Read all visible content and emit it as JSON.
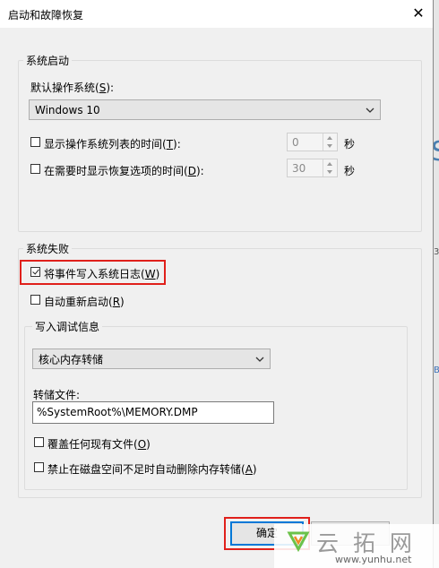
{
  "window": {
    "title": "启动和故障恢复",
    "close_glyph": "✕"
  },
  "background": {
    "letter_s": "S",
    "digit": "3",
    "letter_b": "B"
  },
  "system_startup": {
    "legend": "系统启动",
    "default_os_label_text": "默认操作系统(",
    "default_os_label_key": "S",
    "default_os_label_end": "):",
    "default_os_value": "Windows 10",
    "show_list": {
      "label_text": "显示操作系统列表的时间(",
      "key": "T",
      "label_end": "):",
      "checked": false,
      "value": "0",
      "unit": "秒"
    },
    "show_recovery": {
      "label_text": "在需要时显示恢复选项的时间(",
      "key": "D",
      "label_end": "):",
      "checked": false,
      "value": "30",
      "unit": "秒"
    }
  },
  "system_failure": {
    "legend": "系统失败",
    "write_event": {
      "label_text": "将事件写入系统日志(",
      "key": "W",
      "label_end": ")",
      "checked": true
    },
    "auto_restart": {
      "label_text": "自动重新启动(",
      "key": "R",
      "label_end": ")",
      "checked": false
    },
    "debug_info": {
      "legend": "写入调试信息",
      "dump_type": "核心内存转储",
      "dump_file_label": "转储文件:",
      "dump_file_value": "%SystemRoot%\\MEMORY.DMP",
      "overwrite": {
        "label_text": "覆盖任何现有文件(",
        "key": "O",
        "label_end": ")",
        "checked": false
      },
      "disable_auto_delete": {
        "label_text": "禁止在磁盘空间不足时自动删除内存转储(",
        "key": "A",
        "label_end": ")",
        "checked": false
      }
    }
  },
  "buttons": {
    "ok": "确定"
  },
  "watermark": {
    "text": "云 拓 网",
    "url": "www.yunhu.net"
  },
  "colors": {
    "highlight": "#e0201b",
    "accent": "#0078d7",
    "logo_green": "#6cc24a",
    "logo_orange": "#f08a24"
  }
}
